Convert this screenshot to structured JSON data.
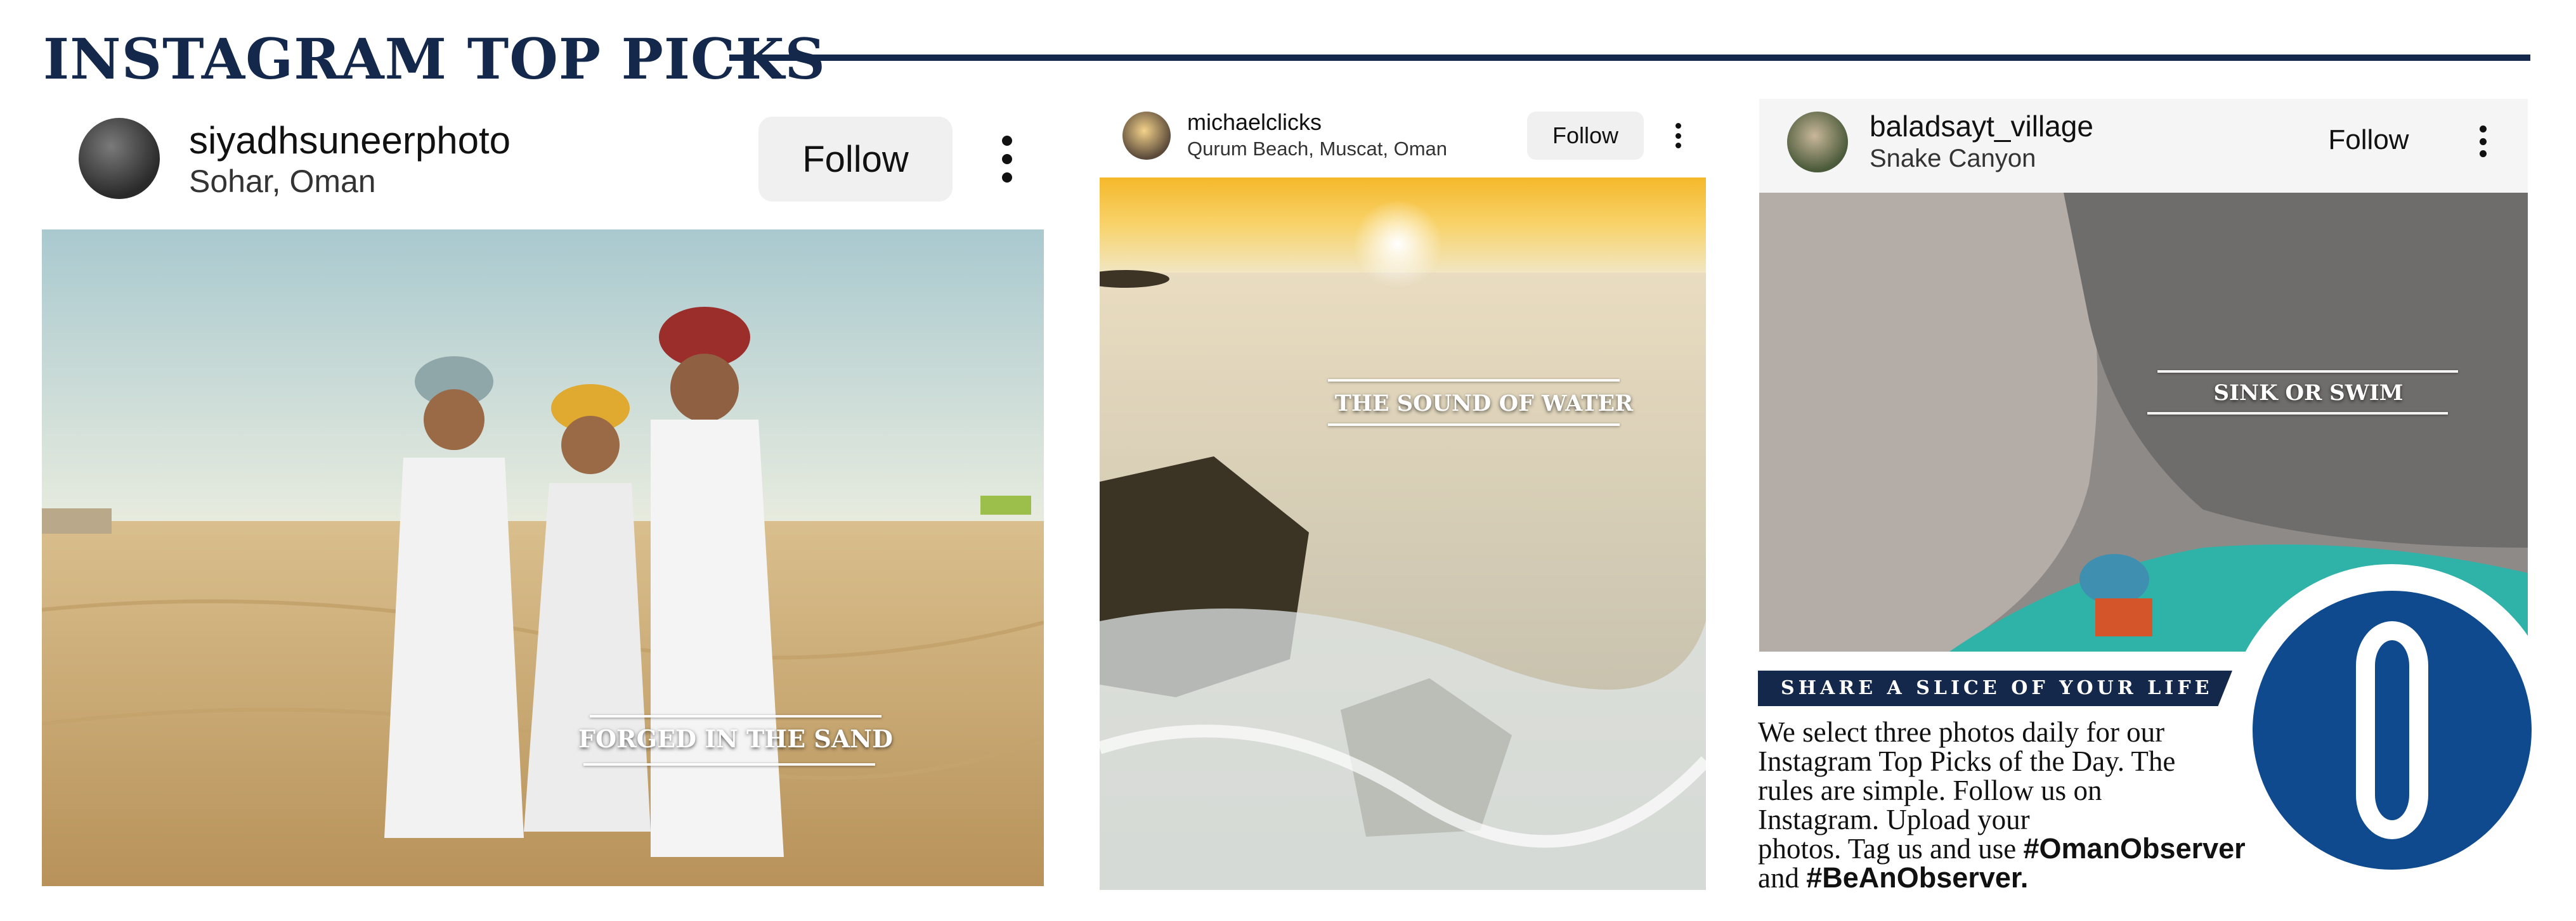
{
  "page": {
    "heading": "INSTAGRAM TOP PICKS",
    "colors": {
      "navy": "#14284b",
      "logo_blue": "#0f4a8e",
      "button_bg": "#f0f0f0"
    }
  },
  "posts": [
    {
      "username": "siyadhsuneerphoto",
      "location": "Sohar, Oman",
      "follow_label": "Follow",
      "caption": "FORGED IN THE SAND",
      "menu_icon": "more-vertical-icon"
    },
    {
      "username": "michaelclicks",
      "location": "Qurum Beach, Muscat, Oman",
      "follow_label": "Follow",
      "caption": "THE SOUND OF WATER",
      "menu_icon": "more-vertical-icon"
    },
    {
      "username": "baladsayt_village",
      "location": "Snake Canyon",
      "follow_label": "Follow",
      "caption": "SINK OR SWIM",
      "menu_icon": "more-vertical-icon"
    }
  ],
  "share": {
    "banner": "SHARE A SLICE OF YOUR LIFE",
    "body_lines": [
      "We select three photos daily for our",
      "Instagram Top Picks of the Day. The",
      "rules are simple. Follow us on",
      "Instagram. Upload your",
      "photos. Tag us and use"
    ],
    "hashtag_1": "#OmanObserver",
    "connector": "and",
    "hashtag_2": "#BeAnObserver."
  },
  "logo": {
    "icon": "oman-observer-o-logo-icon"
  }
}
